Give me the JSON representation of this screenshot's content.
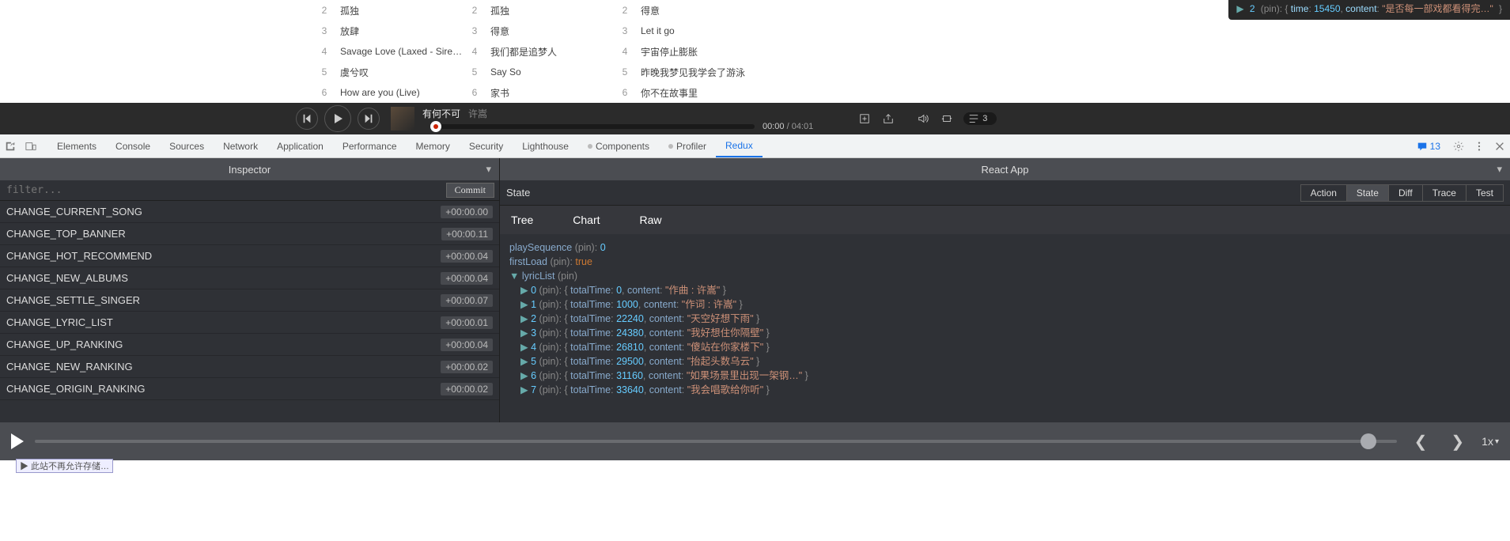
{
  "overlay": {
    "idx": "2",
    "pin": "(pin)",
    "time_key": "time",
    "time_val": "15450",
    "content_key": "content",
    "content_val": "\"是否每一部戏都看得完…\""
  },
  "songLists": [
    [
      {
        "n": "2",
        "t": "孤独"
      },
      {
        "n": "3",
        "t": "放肆"
      },
      {
        "n": "4",
        "t": "Savage Love (Laxed - Siren Be…"
      },
      {
        "n": "5",
        "t": "虞兮叹"
      },
      {
        "n": "6",
        "t": "How are you (Live)"
      }
    ],
    [
      {
        "n": "2",
        "t": "孤独"
      },
      {
        "n": "3",
        "t": "得意"
      },
      {
        "n": "4",
        "t": "我们都是追梦人"
      },
      {
        "n": "5",
        "t": "Say So"
      },
      {
        "n": "6",
        "t": "家书"
      }
    ],
    [
      {
        "n": "2",
        "t": "得意"
      },
      {
        "n": "3",
        "t": "Let it go"
      },
      {
        "n": "4",
        "t": "宇宙停止膨胀"
      },
      {
        "n": "5",
        "t": "昨晚我梦见我学会了游泳"
      },
      {
        "n": "6",
        "t": "你不在故事里"
      }
    ]
  ],
  "player": {
    "song": "有何不可",
    "artist": "许嵩",
    "time_cur": "00:00",
    "time_total": " / 04:01",
    "playlist_count": "3"
  },
  "devtoolsTabs": {
    "elements": "Elements",
    "console": "Console",
    "sources": "Sources",
    "network": "Network",
    "application": "Application",
    "performance": "Performance",
    "memory": "Memory",
    "security": "Security",
    "lighthouse": "Lighthouse",
    "components": "Components",
    "profiler": "Profiler",
    "redux": "Redux"
  },
  "msgCount": "13",
  "inspector": {
    "title": "Inspector",
    "filter_placeholder": "filter...",
    "commit_label": "Commit",
    "actions": [
      {
        "name": "CHANGE_CURRENT_SONG",
        "ts": "+00:00.00"
      },
      {
        "name": "CHANGE_TOP_BANNER",
        "ts": "+00:00.11"
      },
      {
        "name": "CHANGE_HOT_RECOMMEND",
        "ts": "+00:00.04"
      },
      {
        "name": "CHANGE_NEW_ALBUMS",
        "ts": "+00:00.04"
      },
      {
        "name": "CHANGE_SETTLE_SINGER",
        "ts": "+00:00.07"
      },
      {
        "name": "CHANGE_LYRIC_LIST",
        "ts": "+00:00.01"
      },
      {
        "name": "CHANGE_UP_RANKING",
        "ts": "+00:00.04"
      },
      {
        "name": "CHANGE_NEW_RANKING",
        "ts": "+00:00.02"
      },
      {
        "name": "CHANGE_ORIGIN_RANKING",
        "ts": "+00:00.02"
      }
    ]
  },
  "reactApp": {
    "title": "React App",
    "state_label": "State",
    "modes": {
      "action": "Action",
      "state": "State",
      "diff": "Diff",
      "trace": "Trace",
      "test": "Test"
    },
    "subtabs": {
      "tree": "Tree",
      "chart": "Chart",
      "raw": "Raw"
    },
    "playSequence_key": "playSequence",
    "playSequence_pin": "(pin)",
    "playSequence_val": "0",
    "firstLoad_key": "firstLoad",
    "firstLoad_pin": "(pin)",
    "firstLoad_val": "true",
    "lyricList_key": "lyricList",
    "lyricList_pin": "(pin)",
    "lyrics": [
      {
        "i": "0",
        "tt": "0",
        "c": "\"作曲 : 许嵩\""
      },
      {
        "i": "1",
        "tt": "1000",
        "c": "\"作词 : 许嵩\""
      },
      {
        "i": "2",
        "tt": "22240",
        "c": "\"天空好想下雨\""
      },
      {
        "i": "3",
        "tt": "24380",
        "c": "\"我好想住你隔壁\""
      },
      {
        "i": "4",
        "tt": "26810",
        "c": "\"傻站在你家楼下\""
      },
      {
        "i": "5",
        "tt": "29500",
        "c": "\"抬起头数乌云\""
      },
      {
        "i": "6",
        "tt": "31160",
        "c": "\"如果场景里出现一架钢…\""
      },
      {
        "i": "7",
        "tt": "33640",
        "c": "\"我会唱歌给你听\""
      }
    ]
  },
  "transport": {
    "speed": "1x"
  },
  "bottom_text": "▶ 此站不再允许存储…"
}
